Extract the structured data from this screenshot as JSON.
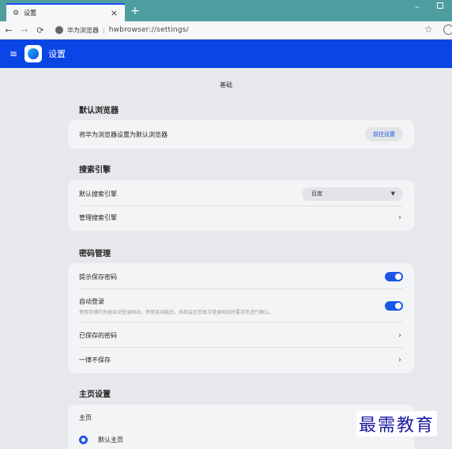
{
  "tab": {
    "title": "设置",
    "close": "×",
    "new_tab": "+"
  },
  "window": {
    "minimize": "–"
  },
  "toolbar": {
    "back": "←",
    "forward": "→",
    "reload": "⟳",
    "site_name": "华为浏览器",
    "separator": "|",
    "url": "hwbrowser://settings/",
    "star": "☆"
  },
  "header": {
    "menu": "≡",
    "title": "设置"
  },
  "page": {
    "section": "基础"
  },
  "default_browser": {
    "title": "默认浏览器",
    "label": "将华为浏览器设置为默认浏览器",
    "button": "前往设置"
  },
  "search_engine": {
    "title": "搜索引擎",
    "default_label": "默认搜索引擎",
    "selected": "百度",
    "caret": "▼",
    "manage_label": "管理搜索引擎",
    "chevron": "›"
  },
  "password": {
    "title": "密码管理",
    "offer_save": "提示保存密码",
    "offer_save_on": true,
    "auto_login": "自动登录",
    "auto_login_desc": "使用存储的凭据自动登录网站。停用该功能后，系统会在您每次登录网站时要求您进行确认。",
    "auto_login_on": true,
    "saved": "已保存的密码",
    "never": "一律不保存",
    "chevron": "›"
  },
  "homepage": {
    "title": "主页设置",
    "label": "主页",
    "option": "默认主页"
  },
  "watermark": "最需教育",
  "colors": {
    "accent": "#0a45e6",
    "tab_strip": "#4e9ea0",
    "toggle_on": "#1c56e8"
  }
}
